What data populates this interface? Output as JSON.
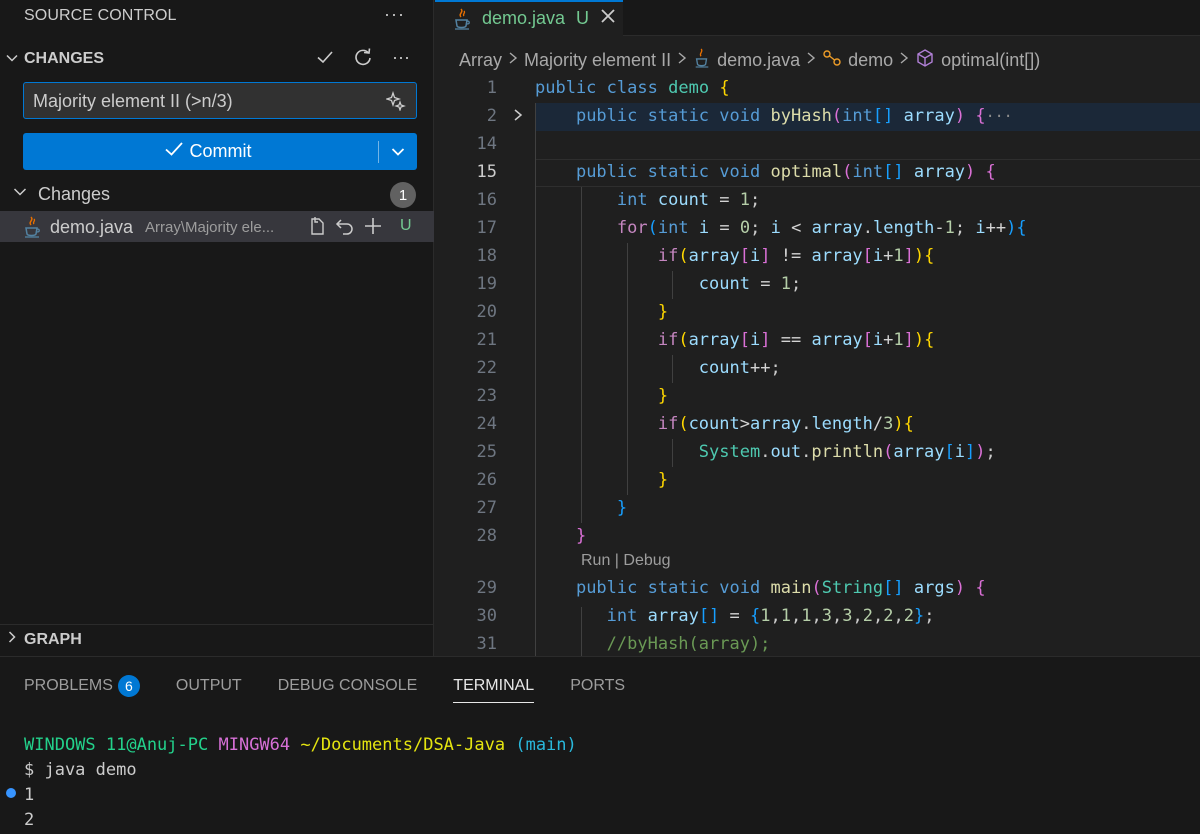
{
  "sidebar": {
    "title": "SOURCE CONTROL",
    "more_label": "···",
    "changes_section": "CHANGES",
    "commit_message": "Majority element II (>n/3)",
    "commit_label": "Commit",
    "changes_group": "Changes",
    "changes_count": "1",
    "file": {
      "name": "demo.java",
      "path": "Array\\Majority ele...",
      "status": "U"
    },
    "graph_section": "GRAPH"
  },
  "editor": {
    "tab": {
      "name": "demo.java",
      "status": "U"
    },
    "breadcrumb": [
      "Array",
      "Majority element II",
      "demo.java",
      "demo",
      "optimal(int[])"
    ],
    "codelens": "Run | Debug"
  },
  "panel": {
    "tabs": [
      "PROBLEMS",
      "OUTPUT",
      "DEBUG CONSOLE",
      "TERMINAL",
      "PORTS"
    ],
    "problems_count": "6",
    "active_tab": "TERMINAL",
    "terminal": {
      "user_host": "WINDOWS 11@Anuj-PC",
      "shell": "MINGW64",
      "cwd": "~/Documents/DSA-Java",
      "branch": "(main)",
      "command": "$ java demo",
      "output": [
        "1",
        "2"
      ]
    }
  },
  "colors": {
    "accent": "#0078d4",
    "untracked": "#73c991",
    "keyword": "#569cd6",
    "control": "#c586c0",
    "function": "#dcdcaa",
    "variable": "#9cdcfe",
    "number": "#b5cea8",
    "comment": "#6a9955"
  }
}
